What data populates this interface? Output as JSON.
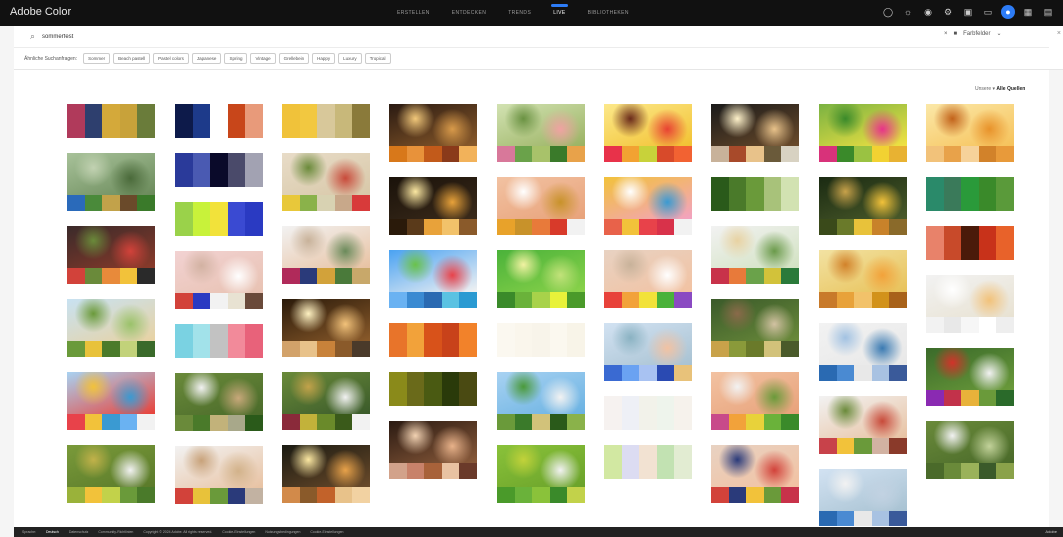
{
  "app": {
    "title": "Adobe Color"
  },
  "nav": {
    "items": [
      {
        "label": "ERSTELLEN",
        "active": false
      },
      {
        "label": "ENTDECKEN",
        "active": false
      },
      {
        "label": "TRENDS",
        "active": false
      },
      {
        "label": "LIVE",
        "active": true
      },
      {
        "label": "BIBLIOTHEKEN",
        "active": false
      }
    ]
  },
  "search": {
    "query": "sommerfest",
    "dropdown_label": "Farbfelder"
  },
  "tags": {
    "label": "Ähnliche Suchanfragen:",
    "items": [
      "Sommer",
      "Beach pastell",
      "Pastel colors",
      "Japanese",
      "Spring",
      "Vintage",
      "Grellebein",
      "Happy",
      "Luxury",
      "Tropical"
    ]
  },
  "filter": {
    "prefix": "Unsere",
    "value": "Alle Quellen"
  },
  "footer": {
    "items": [
      {
        "label": "Sprache:",
        "kind": "plain"
      },
      {
        "label": "Deutsch",
        "kind": "lang"
      },
      {
        "label": "Datenschutz",
        "kind": "plain"
      },
      {
        "label": "Community-Richtlinien",
        "kind": "plain"
      },
      {
        "label": "Copyright © 2024 Adobe. All rights reserved.",
        "kind": "plain"
      },
      {
        "label": "Cookie-Einstellungen",
        "kind": "plain"
      },
      {
        "label": "Nutzungsbedingungen",
        "kind": "plain"
      },
      {
        "label": "Cookie-Einstellungen",
        "kind": "plain"
      }
    ],
    "right": "Adobe"
  },
  "icons": {
    "search": "search-icon",
    "camera": "camera-icon",
    "chevron": "chevron-down-icon",
    "top": [
      "help-icon",
      "sun-icon",
      "palette-icon",
      "settings-icon",
      "library-icon",
      "chat-icon",
      "apps-icon"
    ]
  },
  "cards": [
    {
      "type": "palette",
      "colors": [
        "#b03a5b",
        "#2e3f6e",
        "#d4a93a",
        "#c8a23a",
        "#6a7c3a"
      ]
    },
    {
      "type": "palette",
      "colors": [
        "#0d1a4a",
        "#1d3a8a",
        "#ffffff",
        "#c8461a",
        "#e89a7a"
      ]
    },
    {
      "type": "palette",
      "colors": [
        "#f0c23a",
        "#f2c840",
        "#d8c89a",
        "#c8b87a",
        "#8a7a3a"
      ]
    },
    {
      "type": "photo",
      "photo": [
        "#2a1a12",
        "#8a5a2a",
        "#d89a4a",
        "#f2c87a"
      ],
      "colors": [
        "#d8781a",
        "#e8923a",
        "#c25a1a",
        "#8a3a1a",
        "#f2b25a"
      ]
    },
    {
      "type": "photo",
      "photo": [
        "#d2e2b2",
        "#9ab262",
        "#f0a2a2",
        "#6a9242"
      ],
      "colors": [
        "#d8789a",
        "#6aa24a",
        "#a8c26a",
        "#3a7a2a",
        "#e8a24a"
      ]
    },
    {
      "type": "photo",
      "photo": [
        "#fce88a",
        "#f2c232",
        "#e84232",
        "#6a2a1a"
      ],
      "colors": [
        "#e8324a",
        "#f2a232",
        "#c8d23a",
        "#d84a2a",
        "#f26232"
      ]
    },
    {
      "type": "photo",
      "photo": [
        "#1a1a1a",
        "#6a4a2a",
        "#e8c28a",
        "#fff2ca"
      ],
      "colors": [
        "#c8b29a",
        "#a84a2a",
        "#e8c28a",
        "#6a5a3a",
        "#d8d2c2"
      ]
    },
    {
      "type": "photo",
      "photo": [
        "#7ab242",
        "#f2e242",
        "#e8328a",
        "#3a8a2a"
      ],
      "colors": [
        "#d8327a",
        "#3a8a2a",
        "#9ac242",
        "#f2d232",
        "#e8b232"
      ]
    },
    {
      "type": "photo",
      "photo": [
        "#fbe8a8",
        "#f6c25a",
        "#e8922a",
        "#c2621a"
      ],
      "colors": [
        "#f2c27a",
        "#e8a24a",
        "#f6d29a",
        "#d2822a",
        "#e89a3a"
      ]
    },
    {
      "type": "photo",
      "photo": [
        "#a8c29a",
        "#6a8a5a",
        "#4a6a3a",
        "#c2d2b2"
      ],
      "colors": [
        "#2a6aba",
        "#4a8a3a",
        "#c2a24a",
        "#6a4a2a",
        "#3a7a2a"
      ]
    },
    {
      "type": "palette",
      "colors": [
        "#2a3a9a",
        "#4a5ab2",
        "#0a0a2a",
        "#4a4a6a",
        "#a2a2b2"
      ]
    },
    {
      "type": "photo",
      "photo": [
        "#e8dcc8",
        "#d8c8a8",
        "#c84a3a",
        "#6a8a3a"
      ],
      "colors": [
        "#e8c83a",
        "#8ab24a",
        "#d8d2b2",
        "#c8a88a",
        "#d83a3a"
      ]
    },
    {
      "type": "photo",
      "photo": [
        "#1a120a",
        "#3a2a1a",
        "#e8a23a",
        "#fce8a2"
      ],
      "colors": [
        "#2a1a0a",
        "#5a3a1a",
        "#e8a23a",
        "#f2c26a",
        "#8a5a2a"
      ]
    },
    {
      "type": "photo",
      "photo": [
        "#f2c2a2",
        "#e8a27a",
        "#c8922a",
        "#ffffff"
      ],
      "colors": [
        "#e8a22a",
        "#c8922a",
        "#e87a3a",
        "#d83a2a",
        "#f2f2f2"
      ]
    },
    {
      "type": "photo",
      "photo": [
        "#f2c23a",
        "#f2a2c2",
        "#3a9ad2",
        "#ffffff"
      ],
      "colors": [
        "#e8624a",
        "#f2c23a",
        "#e8424a",
        "#d8324a",
        "#f2f2f2"
      ]
    },
    {
      "type": "palette",
      "colors": [
        "#2a5a1a",
        "#4a7a2a",
        "#6a9a3a",
        "#a8c27a",
        "#d2e2b2"
      ]
    },
    {
      "type": "photo",
      "photo": [
        "#1a2a12",
        "#4a5a2a",
        "#f2c23a",
        "#c8a24a"
      ],
      "colors": [
        "#3a4a1a",
        "#6a7a2a",
        "#e8c23a",
        "#c8822a",
        "#8a6a2a"
      ]
    },
    {
      "type": "palette",
      "colors": [
        "#2a8a6a",
        "#3a7a5a",
        "#2a9a3a",
        "#3a8a2a",
        "#5a9a3a"
      ]
    },
    {
      "type": "palette",
      "colors": [
        "#9ad24a",
        "#c8f23a",
        "#f2e23a",
        "#3a4ad2",
        "#2a3ac2"
      ]
    },
    {
      "type": "photo",
      "photo": [
        "#3a2a2a",
        "#8a3a2a",
        "#d2423a",
        "#6a8a3a"
      ],
      "colors": [
        "#d2423a",
        "#6a8a3a",
        "#e88a3a",
        "#f2c23a",
        "#2a2a2a"
      ]
    },
    {
      "type": "photo",
      "photo": [
        "#f2f2f2",
        "#e8c2a2",
        "#6a8a5a",
        "#c8b29a"
      ],
      "colors": [
        "#b02a5a",
        "#2a3a7a",
        "#d2a23a",
        "#4a7a3a",
        "#c8a86a"
      ]
    },
    {
      "type": "photo",
      "photo": [
        "#f2f2f2",
        "#d2e2c2",
        "#6a9a4a",
        "#e8d2a2"
      ],
      "colors": [
        "#c8324a",
        "#e87a3a",
        "#6aa24a",
        "#d2c23a",
        "#2a7a3a"
      ]
    },
    {
      "type": "palette",
      "colors": [
        "#e8826a",
        "#c84a2a",
        "#4a1a0a",
        "#c8321a",
        "#e8622a"
      ]
    },
    {
      "type": "photo",
      "photo": [
        "#4aa2f2",
        "#f2f2f2",
        "#e8424a",
        "#6ac24a"
      ],
      "colors": [
        "#6ab2f2",
        "#3a8ad2",
        "#2a6ab2",
        "#5ac2e2",
        "#2a9ad2"
      ]
    },
    {
      "type": "photo",
      "photo": [
        "#4ab23a",
        "#8ad24a",
        "#c2e27a",
        "#f2f2a2"
      ],
      "colors": [
        "#3a8a2a",
        "#6ab23a",
        "#a8d24a",
        "#e8f23a",
        "#4a9a2a"
      ]
    },
    {
      "type": "photo",
      "photo": [
        "#e8d2c2",
        "#f2c2a2",
        "#ffffff",
        "#c8b29a"
      ],
      "colors": [
        "#e8423a",
        "#f2a23a",
        "#f2e23a",
        "#4ab23a",
        "#8a4ac2"
      ]
    },
    {
      "type": "photo",
      "photo": [
        "#f2e2a2",
        "#e8c25a",
        "#f2a23a",
        "#d2822a"
      ],
      "colors": [
        "#c87a2a",
        "#e8a23a",
        "#f2c26a",
        "#d2921a",
        "#a8621a"
      ]
    },
    {
      "type": "photo",
      "photo": [
        "#f2d2d2",
        "#e8c2b2",
        "#ffffff",
        "#d2b2a2"
      ],
      "colors": [
        "#d2423a",
        "#2a3ac2",
        "#f2f2f2",
        "#e8e2d2",
        "#6a4a3a"
      ]
    },
    {
      "type": "photo",
      "photo": [
        "#f2f2f2",
        "#e8e2d2",
        "#f2c27a",
        "#ffffff"
      ],
      "colors": [
        "#f2f2f2",
        "#e8e8e8",
        "#f6f6f6",
        "#ffffff",
        "#eeeeee"
      ]
    },
    {
      "type": "photo",
      "photo": [
        "#c8e2f2",
        "#e8d2a2",
        "#9ac26a",
        "#6a9a3a"
      ],
      "colors": [
        "#6a9a3a",
        "#e8c23a",
        "#4a7a2a",
        "#c2d27a",
        "#3a6a2a"
      ]
    },
    {
      "type": "photo",
      "photo": [
        "#2a1a0a",
        "#8a5a2a",
        "#f2c27a",
        "#fff2c2"
      ],
      "colors": [
        "#d2a26a",
        "#e8c28a",
        "#c8823a",
        "#8a5a2a",
        "#4a3a2a"
      ]
    },
    {
      "type": "photo",
      "photo": [
        "#3a5a2a",
        "#6a8a3a",
        "#d2c2a2",
        "#8a6a4a"
      ],
      "colors": [
        "#c8a24a",
        "#8a9a3a",
        "#6a7a2a",
        "#d2c27a",
        "#4a5a2a"
      ]
    },
    {
      "type": "palette",
      "colors": [
        "#e8742a",
        "#f2a23a",
        "#d8521a",
        "#c8421a",
        "#f2822a"
      ]
    },
    {
      "type": "palette",
      "colors": [
        "#fbf8f0",
        "#faf6ec",
        "#f8f4ea",
        "#fbf8ef",
        "#f8f4e8"
      ]
    },
    {
      "type": "photo",
      "photo": [
        "#d2e2f2",
        "#a8c2d2",
        "#f2c2a2",
        "#8ab2c2"
      ],
      "colors": [
        "#3a6ad2",
        "#6aa2f2",
        "#a8c2f2",
        "#2a4ab2",
        "#e8c27a"
      ]
    },
    {
      "type": "photo",
      "photo": [
        "#f2f2f2",
        "#e8e8e8",
        "#3a7ab2",
        "#a2c2e2"
      ],
      "colors": [
        "#2a6ab2",
        "#4a8ad2",
        "#e8e8e8",
        "#a8c2e2",
        "#3a5a9a"
      ]
    },
    {
      "type": "palette",
      "colors": [
        "#7ad2e2",
        "#a2e2ea",
        "#c2c2c2",
        "#f28a9a",
        "#e8627a"
      ]
    },
    {
      "type": "photo",
      "photo": [
        "#3a6a2a",
        "#6a9a3a",
        "#f2f2f2",
        "#d2322a"
      ],
      "colors": [
        "#8a2ab2",
        "#c2324a",
        "#e8b23a",
        "#6a9a3a",
        "#2a6a2a"
      ]
    },
    {
      "type": "photo",
      "photo": [
        "#a8d2f2",
        "#e8423a",
        "#3a9ad2",
        "#f2c23a"
      ],
      "colors": [
        "#e8424a",
        "#f2c23a",
        "#3a9ad2",
        "#6ab2f2",
        "#f2f2f2"
      ]
    },
    {
      "type": "photo",
      "photo": [
        "#6a8a3a",
        "#3a5a2a",
        "#f2f2f2",
        "#c2a24a"
      ],
      "colors": [
        "#8a2a3a",
        "#c2b23a",
        "#6a8a2a",
        "#3a5a1a",
        "#f2f2f2"
      ]
    },
    {
      "type": "palette",
      "colors": [
        "#8a8a1a",
        "#6a6a1a",
        "#4a5a12",
        "#2a3a0a",
        "#4a4a12"
      ]
    },
    {
      "type": "photo",
      "photo": [
        "#a8d2f2",
        "#6ab2e2",
        "#f2f2f2",
        "#4a9a3a"
      ],
      "colors": [
        "#6a9a3a",
        "#3a7a2a",
        "#d2c27a",
        "#2a5a1a",
        "#8ab24a"
      ]
    },
    {
      "type": "photo",
      "photo": [
        "#f2c2a2",
        "#e8a27a",
        "#6a9a3a",
        "#f2f2f2"
      ],
      "colors": [
        "#c84a8a",
        "#f2a23a",
        "#e8d23a",
        "#6ab23a",
        "#3a8a2a"
      ]
    },
    {
      "type": "photo",
      "photo": [
        "#6a8a3a",
        "#4a6a2a",
        "#c8a87a",
        "#f2f2f2"
      ],
      "colors": [
        "#6a8a3a",
        "#4a7a2a",
        "#c2b27a",
        "#a8a88a",
        "#2a5a1a"
      ]
    },
    {
      "type": "palette",
      "colors": [
        "#f6f2f0",
        "#eef0f6",
        "#f2f2ea",
        "#eef4ec",
        "#f6f2ec"
      ]
    },
    {
      "type": "photo",
      "photo": [
        "#f2f2f2",
        "#e8c2a2",
        "#c84a3a",
        "#6a8a3a"
      ],
      "colors": [
        "#c8424a",
        "#f2c23a",
        "#6a9a3a",
        "#d2b2a2",
        "#8a3a2a"
      ]
    },
    {
      "type": "photo",
      "photo": [
        "#2a1a12",
        "#8a5a3a",
        "#e8b28a",
        "#f2d2b2"
      ],
      "colors": [
        "#d2a28a",
        "#c8826a",
        "#a8623a",
        "#e8c2a2",
        "#6a3a2a"
      ]
    },
    {
      "type": "photo",
      "photo": [
        "#6a8a3a",
        "#4a6a2a",
        "#c2d29a",
        "#f2f2f2"
      ],
      "colors": [
        "#4a6a2a",
        "#6a8a3a",
        "#9ab25a",
        "#3a5a2a",
        "#8aa24a"
      ]
    },
    {
      "type": "photo",
      "photo": [
        "#7a9a3a",
        "#5a7a2a",
        "#f2f2f2",
        "#c2b24a"
      ],
      "colors": [
        "#9ab23a",
        "#f2c23a",
        "#c2d24a",
        "#6a9a3a",
        "#4a7a2a"
      ]
    },
    {
      "type": "photo",
      "photo": [
        "#1a1a12",
        "#6a4a2a",
        "#e8a24a",
        "#fce8a2"
      ],
      "colors": [
        "#d28a4a",
        "#8a5a2a",
        "#c2622a",
        "#e8c28a",
        "#f2d2a2"
      ]
    },
    {
      "type": "photo",
      "photo": [
        "#8ac23a",
        "#6aa22a",
        "#f2f2f2",
        "#c2d23a"
      ],
      "colors": [
        "#4a9a2a",
        "#6ab23a",
        "#8ac23a",
        "#3a8a2a",
        "#c2d24a"
      ]
    },
    {
      "type": "palette",
      "colors": [
        "#d2e8a2",
        "#dcdcf2",
        "#f2e2d2",
        "#c2e2b2",
        "#e2ecd2"
      ]
    },
    {
      "type": "photo",
      "photo": [
        "#e8d2c2",
        "#f2c2a2",
        "#d2423a",
        "#2a3a7a"
      ],
      "colors": [
        "#d2423a",
        "#2a3a7a",
        "#f2c23a",
        "#6a9a3a",
        "#c8324a"
      ]
    },
    {
      "type": "photo",
      "photo": [
        "#f2f2f2",
        "#e8c2a2",
        "#d2b28a",
        "#c8a27a"
      ],
      "colors": [
        "#d2423a",
        "#e8c23a",
        "#6a9a3a",
        "#2a3a7a",
        "#c2b2a2"
      ]
    },
    {
      "type": "photo",
      "photo": [
        "#d2e2f2",
        "#a8c2d2",
        "#c2d2e2",
        "#f2f2f2"
      ],
      "colors": [
        "#2a6ab2",
        "#4a8ad2",
        "#e8e8e8",
        "#a8c2e2",
        "#3a5a9a"
      ]
    }
  ]
}
